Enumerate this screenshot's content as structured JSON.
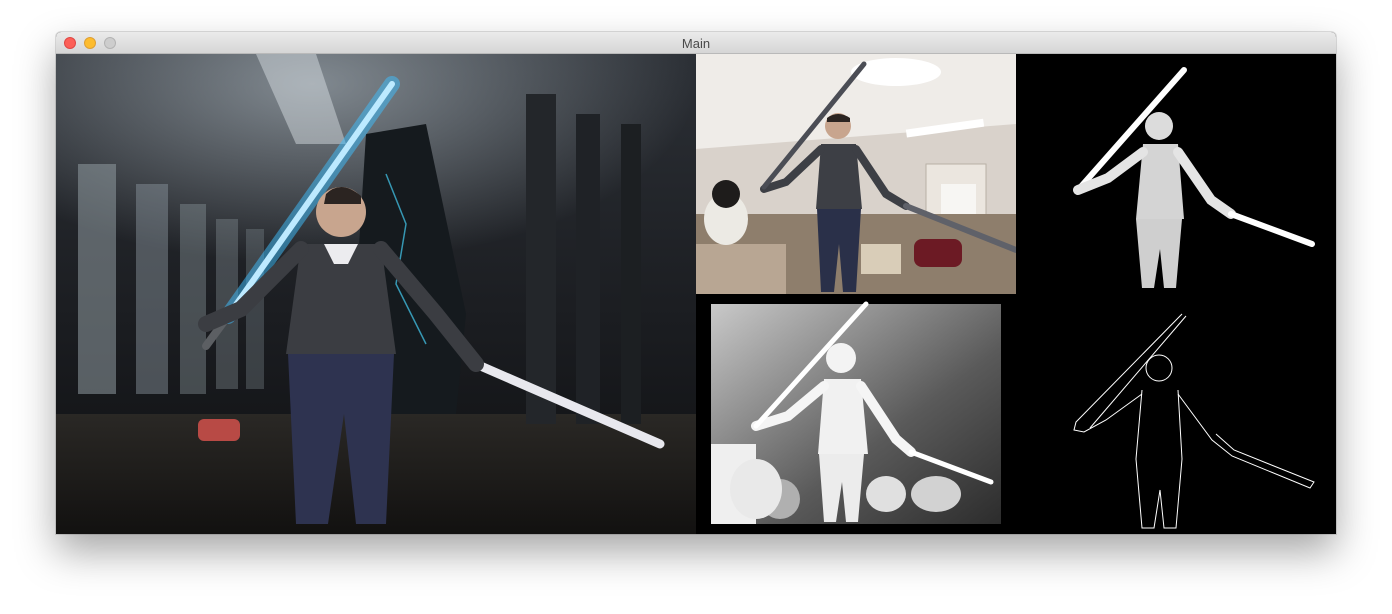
{
  "window": {
    "title": "Main"
  },
  "panes": {
    "composite": "composite-view",
    "camera": "camera-view",
    "depth": "depth-view",
    "mask": "mask-view",
    "contour": "contour-view"
  },
  "colors": {
    "saber_glow": "#3fc0ff",
    "close": "#fc5f57",
    "minimize": "#fdbc2e",
    "zoom": "#cdcdcd"
  }
}
